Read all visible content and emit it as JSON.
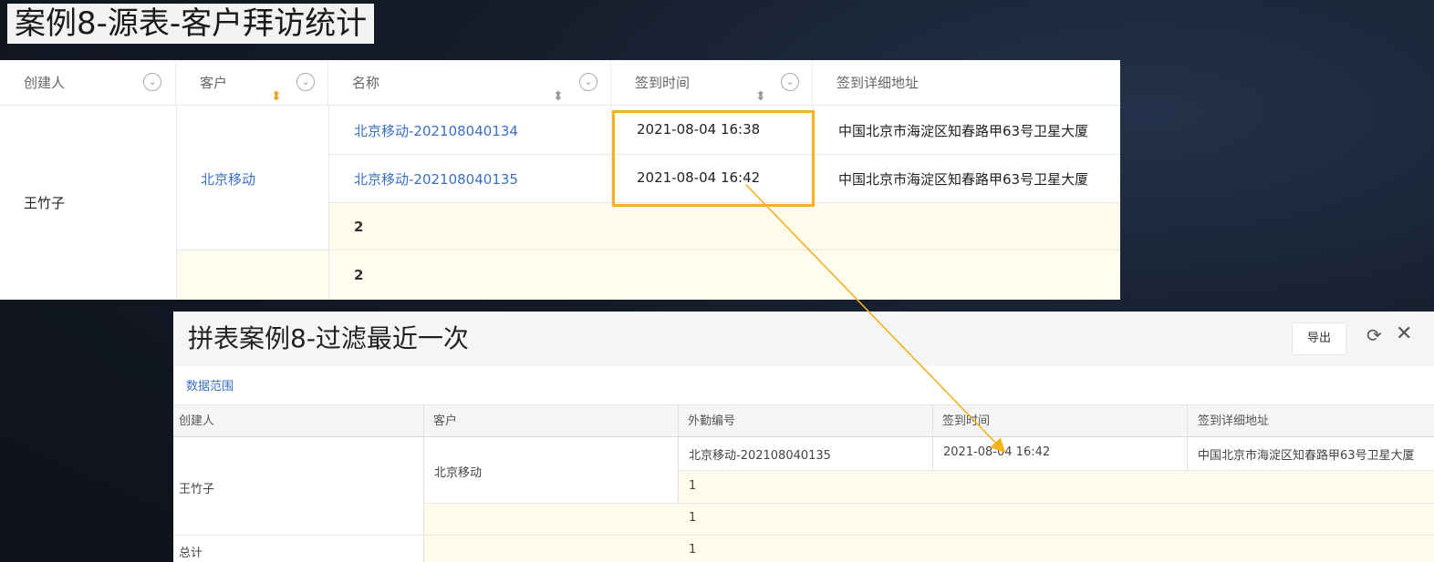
{
  "page_title": "案例8-源表-客户拜访统计",
  "source_table": {
    "headers": [
      "创建人",
      "客户",
      "名称",
      "签到时间",
      "签到详细地址"
    ],
    "creator": "王竹子",
    "customer": "北京移动",
    "rows": [
      {
        "name": "北京移动-202108040134",
        "time": "2021-08-04 16:38",
        "address": "中国北京市海淀区知春路甲63号卫星大厦"
      },
      {
        "name": "北京移动-202108040135",
        "time": "2021-08-04 16:42",
        "address": "中国北京市海淀区知春路甲63号卫星大厦"
      }
    ],
    "subtotal": "2",
    "total": "2"
  },
  "result_panel": {
    "title": "拼表案例8-过滤最近一次",
    "export_label": "导出",
    "data_scope": "数据范围",
    "headers": [
      "创建人",
      "客户",
      "外勤编号",
      "签到时间",
      "签到详细地址"
    ],
    "creator": "王竹子",
    "customer": "北京移动",
    "row": {
      "id": "北京移动-202108040135",
      "time": "2021-08-04 16:42",
      "address": "中国北京市海淀区知春路甲63号卫星大厦"
    },
    "count1": "1",
    "count2": "1",
    "total_label": "总计",
    "total_value": "1"
  },
  "colors": {
    "highlight": "#f5b120",
    "link": "#3a6fc7",
    "subtotal_fill": "#fdfbe9"
  }
}
